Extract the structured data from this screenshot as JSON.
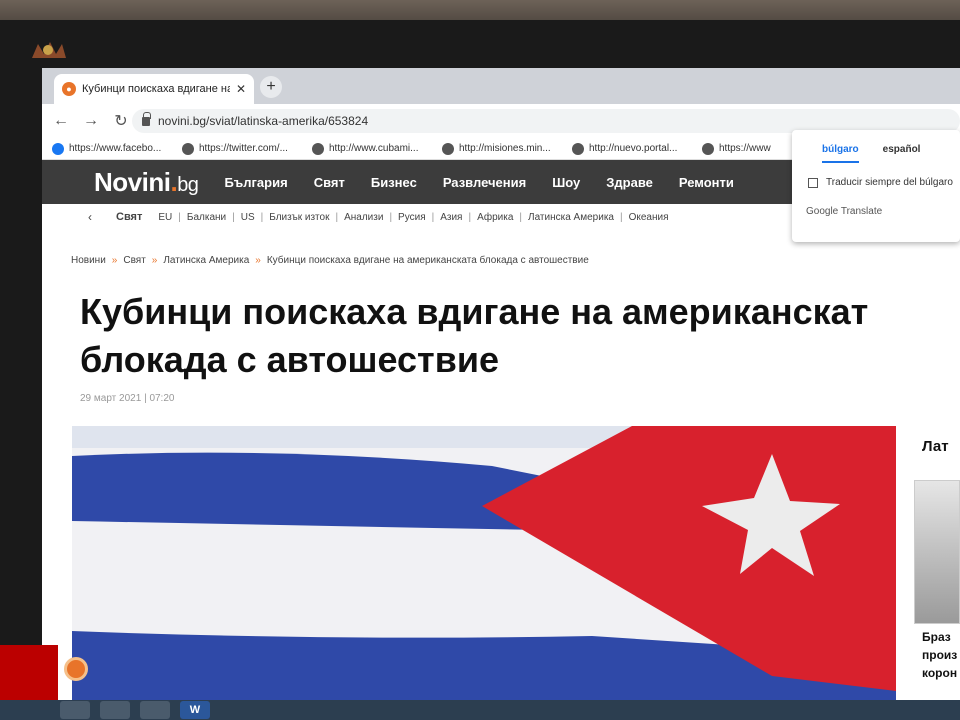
{
  "browser": {
    "tab_title": "Кубинци поискаха вдигане на а",
    "tab_close": "✕",
    "new_tab": "+",
    "back": "←",
    "forward": "→",
    "reload": "↻",
    "url": "novini.bg/sviat/latinska-amerika/653824",
    "bookmarks": [
      "https://www.facebo...",
      "https://twitter.com/...",
      "http://www.cubami...",
      "http://misiones.min...",
      "http://nuevo.portal...",
      "https://www"
    ]
  },
  "site": {
    "logo_main": "Novini",
    "logo_dot": ".",
    "logo_tld": "bg",
    "menu": [
      "България",
      "Свят",
      "Бизнес",
      "Развлечения",
      "Шоу",
      "Здраве",
      "Ремонти"
    ],
    "subnav_back": "‹",
    "subnav_section": "Свят",
    "subnav_items": [
      "EU",
      "Балкани",
      "US",
      "Близък изток",
      "Анализи",
      "Русия",
      "Азия",
      "Африка",
      "Латинска Америка",
      "Океания"
    ],
    "breadcrumb": [
      "Новини",
      "Свят",
      "Латинска Америка",
      "Кубинци поискаха вдигане на американската блокада с автошествие"
    ],
    "breadcrumb_sep": "»",
    "headline_line1": "Кубинци поискаха вдигане на американскат",
    "headline_line2": "блокада с автошествие",
    "date": "29 март 2021 | 07:20",
    "side_title": "Лат",
    "side_text": [
      "Браз",
      "произ",
      "корон"
    ]
  },
  "translate_popup": {
    "tab_source": "búlgaro",
    "tab_target": "español",
    "checkbox_label": "Traducir siempre del búlgaro",
    "brand": "Google Translate"
  },
  "taskbar": {
    "word_label": "W"
  },
  "colors": {
    "accent": "#e8742a",
    "nav_bg": "#3c3c3c",
    "flag_blue": "#2f49a8",
    "flag_red": "#d8212d"
  }
}
